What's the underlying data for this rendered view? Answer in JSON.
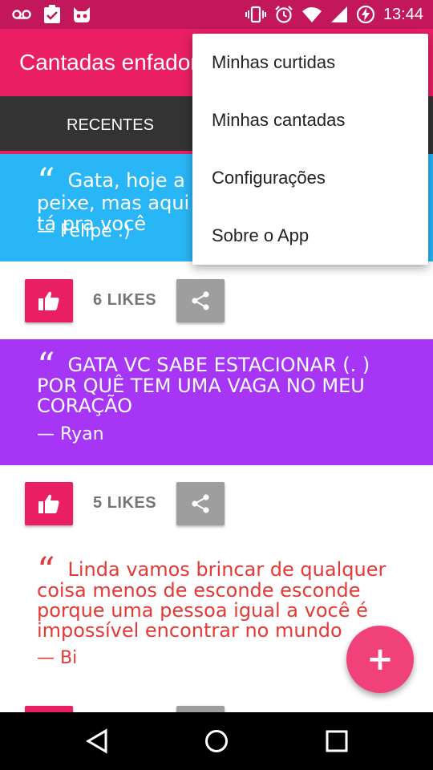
{
  "status_bar": {
    "time": "13:44",
    "left_icons": [
      "voicemail-icon",
      "clipboard-check-icon",
      "cat-face-icon"
    ],
    "right_icons": [
      "vibrate-icon",
      "alarm-icon",
      "wifi-icon",
      "signal-icon",
      "battery-charging-icon"
    ],
    "color": "#c2185b"
  },
  "app_bar": {
    "title": "Cantadas enfadonhas",
    "color": "#e91e63"
  },
  "tabs": [
    {
      "label": "RECENTES",
      "selected": true
    }
  ],
  "posts": [
    {
      "quote_mark": "“",
      "text": "Gata, hoje a maré não tá pra peixe, mas aqui em casa a sua cama tá pra você",
      "author": "— Felipe :)",
      "likes": "6 LIKES",
      "background": "#29b6f6",
      "text_color": "#ffffff"
    },
    {
      "quote_mark": "“",
      "text": "GATA VC SABE ESTACIONAR (. ) POR QUÊ TEM UMA VAGA NO MEU CORAÇÃO",
      "author": "— Ryan",
      "likes": "5 LIKES",
      "background": "#a635f5",
      "text_color": "#ffffff"
    },
    {
      "quote_mark": "“",
      "text": "Linda vamos brincar de qualquer coisa menos de esconde esconde porque uma pessoa igual a você é impossível encontrar no mundo",
      "author": "— Bi",
      "likes": "",
      "background": "#ffffff",
      "text_color": "#e53935"
    }
  ],
  "fab": {
    "label": "+",
    "color": "#f0417a"
  },
  "overflow_menu": {
    "items": [
      {
        "label": "Minhas curtidas"
      },
      {
        "label": "Minhas cantadas"
      },
      {
        "label": "Configurações"
      },
      {
        "label": "Sobre o App"
      }
    ]
  },
  "nav_bar": {
    "icons": [
      "back-icon",
      "home-icon",
      "recents-icon"
    ]
  }
}
